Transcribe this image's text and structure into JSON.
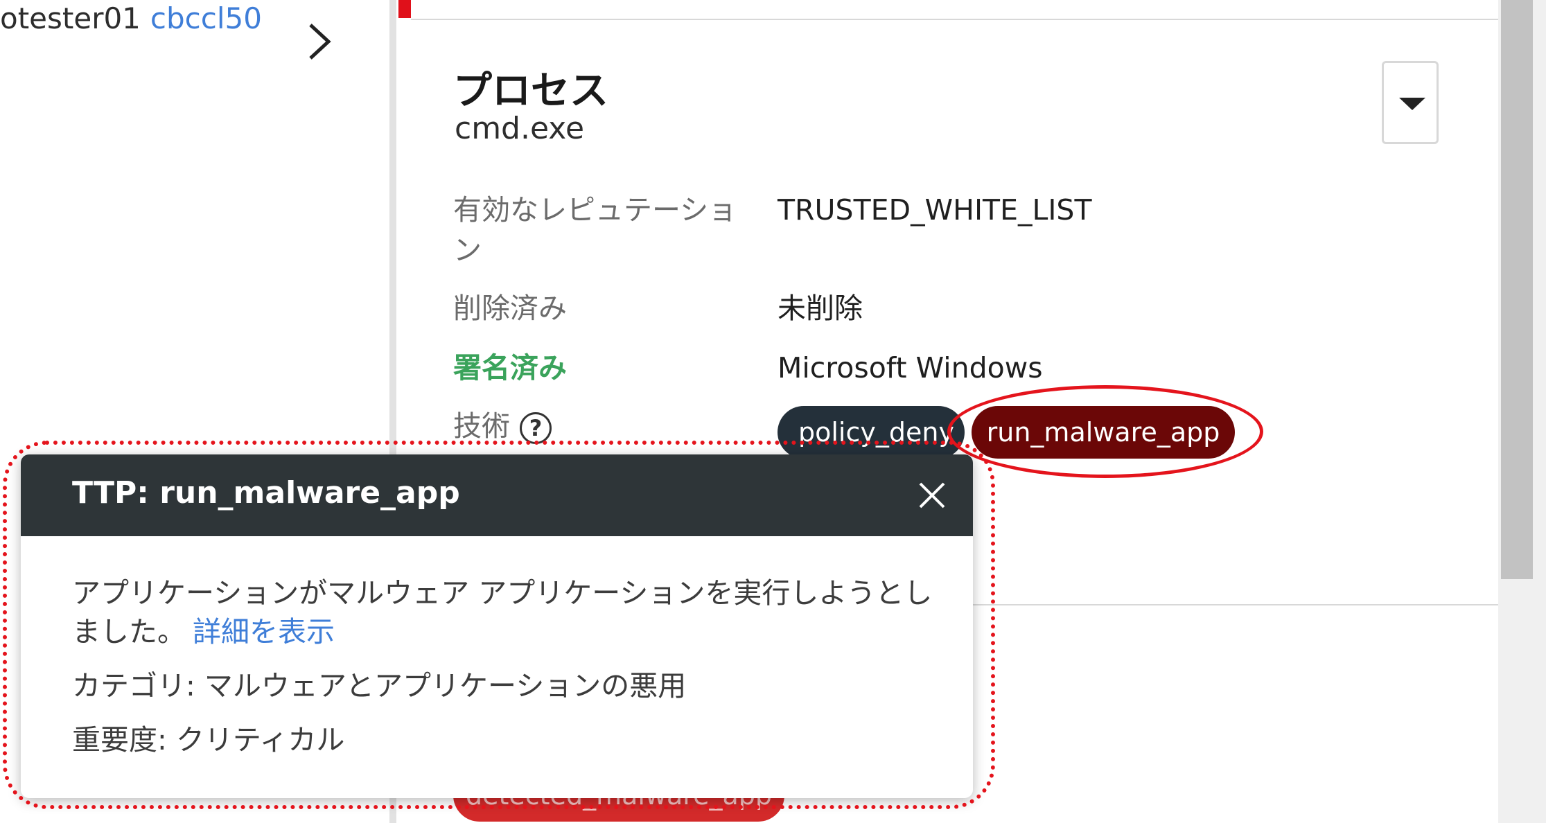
{
  "left": {
    "user_text": "otester01",
    "user_link": "cbccl50"
  },
  "process": {
    "title": "プロセス",
    "name": "cmd.exe"
  },
  "fields": {
    "reputation_label_1": "有効なレピュテーショ",
    "reputation_label_2": "ン",
    "reputation_value": "TRUSTED_WHITE_LIST",
    "deleted_label": "削除済み",
    "deleted_value": "未削除",
    "signed_label": "署名済み",
    "signed_value": "Microsoft Windows",
    "technique_label": "技術",
    "help_glyph": "?"
  },
  "tags": {
    "tag1": "policy_deny",
    "tag2": "run_malware_app",
    "bottom_tag": "detected_malware_app"
  },
  "popup": {
    "title": "TTP: run_malware_app",
    "description": "アプリケーションがマルウェア アプリケーションを実行しようとしました。",
    "details_link": "詳細を表示",
    "category": "カテゴリ: マルウェアとアプリケーションの悪用",
    "severity": "重要度: クリティカル"
  },
  "colors": {
    "accent_red": "#e4141c",
    "maroon_pill": "#6b0707",
    "dark_pill": "#24303a",
    "signed_green": "#3aa35b",
    "link_blue": "#3f7ed8"
  }
}
